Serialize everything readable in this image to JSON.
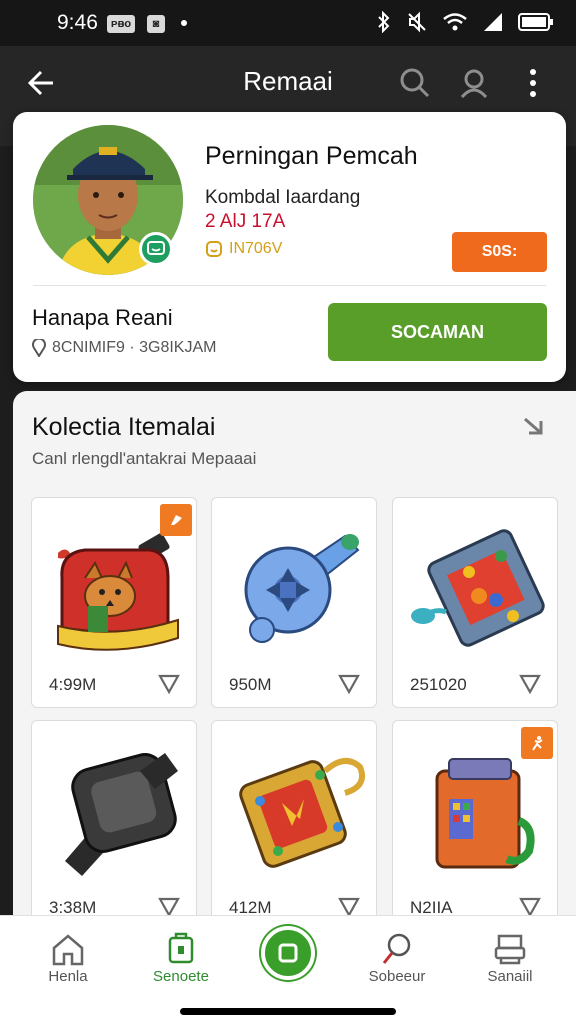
{
  "status_bar": {
    "time": "9:46",
    "badge1": "ᴘᴃᴏ",
    "badge2": "◙"
  },
  "app_bar": {
    "title": "Remaai"
  },
  "profile": {
    "name": "Perningan Pemcah",
    "subtitle": "Kombdal Iaardang",
    "id": "2 AlJ 17A",
    "level": "IN706V",
    "orange_button": "S0S:",
    "secondary_name": "Hanapa Reani",
    "meta": "8CNIMIF9 · 3G8IKJAM",
    "green_button": "SOCAMAN"
  },
  "collection": {
    "title": "Kolectia Itemalai",
    "subtitle": "Canl rlengdl'antakrai Mepaaai",
    "items": [
      {
        "value": "4:99M",
        "icon": "jetpack-fox-icon"
      },
      {
        "value": "950M",
        "icon": "blue-gadget-icon"
      },
      {
        "value": "251020",
        "icon": "toy-console-icon"
      },
      {
        "value": "3:38M",
        "icon": "black-watch-icon"
      },
      {
        "value": "412M",
        "icon": "gold-tablet-icon"
      },
      {
        "value": "N2IIA",
        "icon": "orange-box-icon"
      }
    ]
  },
  "bottom_nav": {
    "items": [
      {
        "label": "Henla",
        "icon": "home-icon"
      },
      {
        "label": "Senoete",
        "icon": "card-icon"
      },
      {
        "label": "Sobeeur",
        "icon": "search-icon"
      },
      {
        "label": "Sanaiil",
        "icon": "printer-icon"
      }
    ]
  },
  "colors": {
    "accent_green": "#5a9e2a",
    "accent_orange": "#f06a1d",
    "id_red": "#c8102e"
  }
}
